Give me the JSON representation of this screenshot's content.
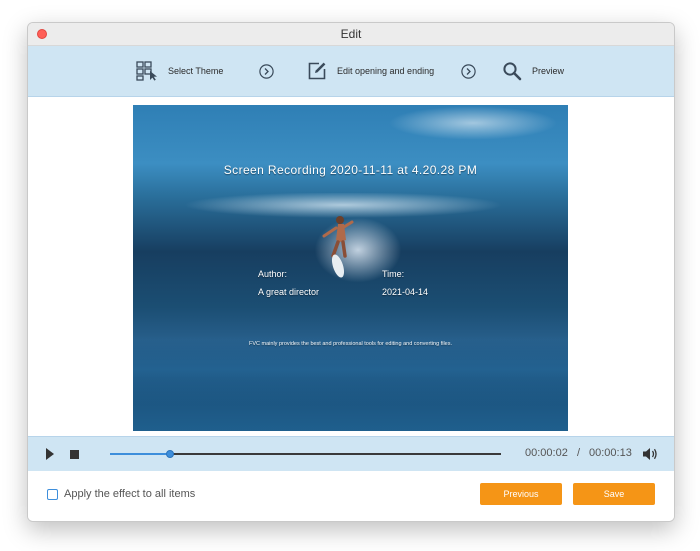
{
  "window": {
    "title": "Edit"
  },
  "steps": [
    {
      "label": "Select Theme",
      "icon": "select-theme-icon"
    },
    {
      "label": "Edit opening and ending",
      "icon": "edit-icon"
    },
    {
      "label": "Preview",
      "icon": "search-icon"
    }
  ],
  "preview": {
    "title": "Screen Recording 2020-11-11 at 4.20.28 PM",
    "author_label": "Author:",
    "author_value": "A great director",
    "time_label": "Time:",
    "time_value": "2021-04-14",
    "tagline": "FVC mainly provides the best and professional tools for editing and converting files."
  },
  "player": {
    "current_time": "00:00:02",
    "separator": "/",
    "total_time": "00:00:13",
    "progress": 0.154
  },
  "footer": {
    "apply_label": "Apply the effect to all items",
    "apply_checked": false,
    "previous_label": "Previous",
    "save_label": "Save"
  },
  "colors": {
    "accent": "#f59516",
    "toolbar_bg": "#cfe5f3",
    "progress": "#3d8edb"
  }
}
